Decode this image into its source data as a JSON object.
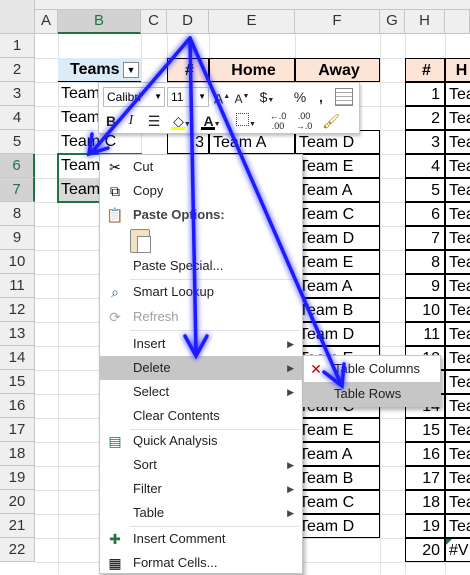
{
  "columns": [
    "A",
    "B",
    "C",
    "D",
    "E",
    "F",
    "G",
    "H"
  ],
  "rows": [
    "1",
    "2",
    "3",
    "4",
    "5",
    "6",
    "7",
    "8",
    "9",
    "10",
    "11",
    "12",
    "13",
    "14",
    "15",
    "16",
    "17",
    "18",
    "19",
    "20",
    "21",
    "22"
  ],
  "teams_table": {
    "header": "Teams",
    "rows": [
      "Team A",
      "Team B",
      "Team C",
      "Team D",
      "Team E"
    ]
  },
  "match_table": {
    "headers": {
      "num": "#",
      "home": "Home",
      "away": "Away"
    },
    "row5": {
      "num": "3",
      "home": "Team A",
      "away": "Team D"
    },
    "away_rows": [
      "Team E",
      "Team A",
      "Team C",
      "Team D",
      "Team E",
      "Team A",
      "Team B",
      "Team D",
      "Team E",
      "Team B",
      "Team C",
      "Team E",
      "Team A",
      "Team B",
      "Team C",
      "Team D"
    ]
  },
  "right_table": {
    "header_num": "#",
    "header_partial": "H",
    "nums": [
      "1",
      "2",
      "3",
      "4",
      "5",
      "6",
      "7",
      "8",
      "9",
      "10",
      "11",
      "12",
      "13",
      "14",
      "15",
      "16",
      "17",
      "18",
      "19",
      "20"
    ],
    "team_partial": [
      "Tea",
      "Tea",
      "Tea",
      "Tea",
      "Tea",
      "Tea",
      "Tea",
      "Tea",
      "Tea",
      "Tea",
      "Tea",
      "Tea",
      "Tea",
      "Tea",
      "Tea",
      "Tea",
      "Tea",
      "Tea",
      "Tea",
      "#V"
    ]
  },
  "mini_toolbar": {
    "font_name": "Calibri",
    "font_size": "11",
    "bold": "B",
    "italic": "I",
    "currency": "$",
    "percent": "%",
    "comma": ","
  },
  "context_menu": {
    "cut": "Cut",
    "copy": "Copy",
    "paste_options": "Paste Options:",
    "paste_special": "Paste Special...",
    "smart_lookup": "Smart Lookup",
    "refresh": "Refresh",
    "insert": "Insert",
    "delete": "Delete",
    "select": "Select",
    "clear_contents": "Clear Contents",
    "quick_analysis": "Quick Analysis",
    "sort": "Sort",
    "filter": "Filter",
    "table": "Table",
    "insert_comment": "Insert Comment",
    "format_cells": "Format Cells..."
  },
  "delete_submenu": {
    "table_columns": "Table Columns",
    "table_rows": "Table Rows"
  },
  "colors": {
    "excel_green": "#217346",
    "annotation_blue": "#1a1aff",
    "header_orange": "#fce4d6",
    "menu_highlight": "#c6c6c6"
  }
}
